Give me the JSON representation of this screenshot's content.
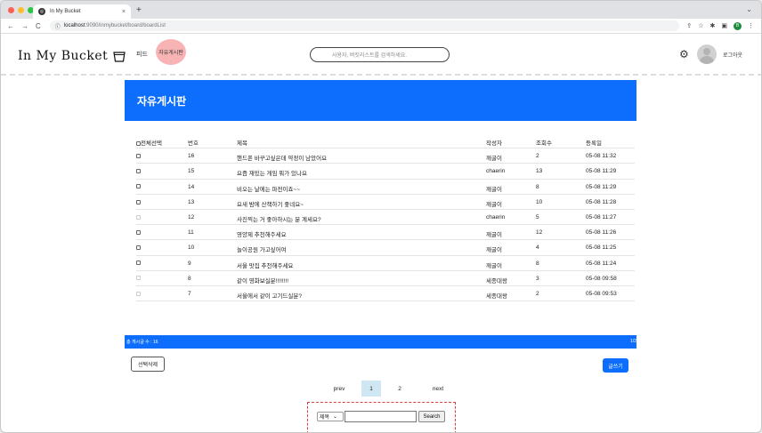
{
  "browser": {
    "tab_title": "In My Bucket",
    "tab_close": "×",
    "new_tab": "+",
    "url_host": "localhost",
    "url_path": ":9090/inmybucket/board/boardList",
    "back": "←",
    "forward": "→",
    "reload": "C",
    "info_icon": "ⓘ",
    "profile_initial": "B",
    "tabbar_chevron": "⌄"
  },
  "header": {
    "logo": "In My Bucket",
    "nav_feed": "피드",
    "nav_board": "자유게시판",
    "search_placeholder": "사용자, 버킷리스트를 검색하세요.",
    "logout": "로그아웃"
  },
  "board": {
    "title": "자유게시판",
    "columns": {
      "select_all": "전체선택",
      "no": "번호",
      "title": "제목",
      "writer": "작성자",
      "views": "조회수",
      "date": "등록일"
    },
    "rows": [
      {
        "no": "16",
        "title": "핸드폰 바꾸고싶은데 약정이 남았어요",
        "writer": "깨굴이",
        "views": "2",
        "date": "05-08 11:32"
      },
      {
        "no": "15",
        "title": "요즘 재밌는 게임 뭐가 있나요",
        "writer": "chaerin",
        "views": "13",
        "date": "05-08 11:29"
      },
      {
        "no": "14",
        "title": "비오는 날에는 파전이죠~~",
        "writer": "깨굴이",
        "views": "8",
        "date": "05-08 11:29"
      },
      {
        "no": "13",
        "title": "요새 밤에 산책하기 좋네요~",
        "writer": "깨굴이",
        "views": "10",
        "date": "05-08 11:28"
      },
      {
        "no": "12",
        "title": "사진찍는 거 좋아하시는 분 계세요?",
        "writer": "chaerin",
        "views": "5",
        "date": "05-08 11:27"
      },
      {
        "no": "11",
        "title": "영양제 추천해주세요",
        "writer": "깨굴이",
        "views": "12",
        "date": "05-08 11:26"
      },
      {
        "no": "10",
        "title": "놀이공원 가고싶어여",
        "writer": "깨굴이",
        "views": "4",
        "date": "05-08 11:25"
      },
      {
        "no": "9",
        "title": "서울 맛집 추천해주세요",
        "writer": "깨굴이",
        "views": "8",
        "date": "05-08 11:24"
      },
      {
        "no": "8",
        "title": "같이 영화보실분!!!!!!!!",
        "writer": "세종대왕",
        "views": "3",
        "date": "05-08 09:58"
      },
      {
        "no": "7",
        "title": "서울에서 같이 고기드실분?",
        "writer": "세종대왕",
        "views": "2",
        "date": "05-08 09:53"
      }
    ],
    "total_label": "총 게시글 수 : 16",
    "page_info": "1/2",
    "delete_button": "선택삭제",
    "write_button": "글쓰기"
  },
  "pagination": {
    "prev": "prev",
    "pages": [
      "1",
      "2"
    ],
    "next": "next",
    "current": "1"
  },
  "search": {
    "field_option": "제목",
    "button": "Search"
  },
  "colors": {
    "primary": "#0d6efd",
    "board_tab_highlight": "#f8b4b4",
    "current_page": "#cfe7f3",
    "search_box_outline": "#d9403f"
  }
}
